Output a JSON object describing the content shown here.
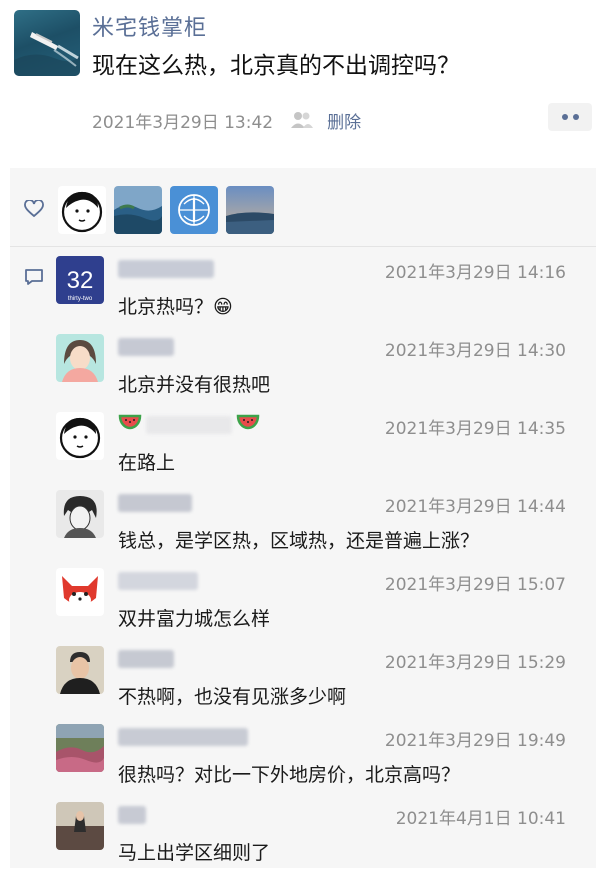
{
  "post": {
    "poster_name": "米宅钱掌柜",
    "text": "现在这么热，北京真的不出调控吗？",
    "time": "2021年3月29日 13:42",
    "delete_label": "删除"
  },
  "icons": {
    "people": "people-icon",
    "more": "more-dots-icon",
    "like": "heart-icon",
    "comment": "comment-icon"
  },
  "comments": [
    {
      "time": "2021年3月29日 14:16",
      "text": "北京热吗？😁"
    },
    {
      "time": "2021年3月29日 14:30",
      "text": "北京并没有很热吧"
    },
    {
      "time": "2021年3月29日 14:35",
      "text": "在路上"
    },
    {
      "time": "2021年3月29日 14:44",
      "text": "钱总，是学区热，区域热，还是普遍上涨？"
    },
    {
      "time": "2021年3月29日 15:07",
      "text": "双井富力城怎么样"
    },
    {
      "time": "2021年3月29日 15:29",
      "text": "不热啊，也没有见涨多少啊"
    },
    {
      "time": "2021年3月29日 19:49",
      "text": "很热吗？对比一下外地房价，北京高吗？"
    },
    {
      "time": "2021年4月1日 10:41",
      "text": "马上出学区细则了"
    }
  ],
  "colors": {
    "name_link": "#5a6f96",
    "timestamp": "#8e8e8e",
    "panel_bg": "#f6f6f6"
  }
}
